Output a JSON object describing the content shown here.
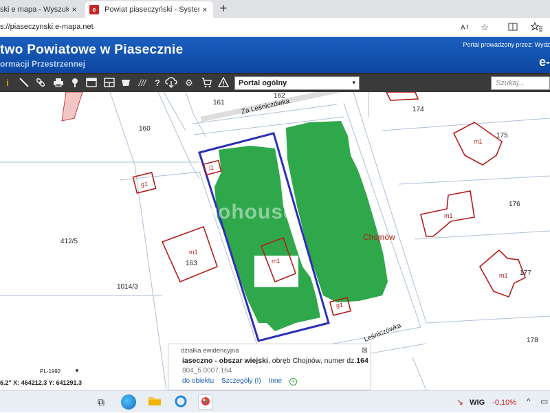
{
  "browser": {
    "tabs": [
      {
        "title": "ski e mapa - Wyszukaj",
        "active": false
      },
      {
        "title": "Powiat piaseczyński - System Info",
        "active": true
      }
    ],
    "favicon_text": "e",
    "url": "s://piaseczynski.e-mapa.net",
    "new_tab": "+",
    "close": "×"
  },
  "header": {
    "title": "twoPowiatowe w Piasecznie",
    "title_display": "two Powiatowe w Piasecznie",
    "subtitle": "ormacji Przestrzennej",
    "right_text": "Portal prowadzony przez: Wydz",
    "brand": "e-"
  },
  "toolbar": {
    "portal_select": "Portal ogólny",
    "portal_arrow": "▾",
    "search_placeholder": "Szukaj..."
  },
  "map": {
    "parcels": [
      "162",
      "161",
      "160",
      "174",
      "175",
      "176",
      "177",
      "178",
      "412/5",
      "163",
      "1014/3"
    ],
    "building_labels": [
      "m1",
      "m1",
      "m1",
      "m1",
      "m1"
    ],
    "small_labels": [
      "g1",
      "g1",
      "i1"
    ],
    "streets": [
      "Za Leśniczówka",
      "Leśniczówka"
    ],
    "place": "Chojnów",
    "watermark": "metrohouse"
  },
  "popup": {
    "title": "działka ewidencyjna",
    "name": "iaseczno - obszar wiejski",
    "rest": ", obręb Chojnów, numer dz.",
    "number": "164",
    "id": "804_5.0007.164",
    "links": [
      "do obiektu",
      "Szczegóły (I)",
      "Inne"
    ],
    "close": "⊠"
  },
  "coords": {
    "crs": "PL-1992",
    "text": "6.2\"  X: 464212.3  Y: 641291.3"
  },
  "taskbar": {
    "stock_ticker": "WIG",
    "stock_change": "-0,10%"
  },
  "colors": {
    "header_blue": "#0d47a1",
    "parcel_red": "#b71c1c",
    "selection_blue": "#2e2fb8",
    "greenery": "#2ea84a"
  }
}
